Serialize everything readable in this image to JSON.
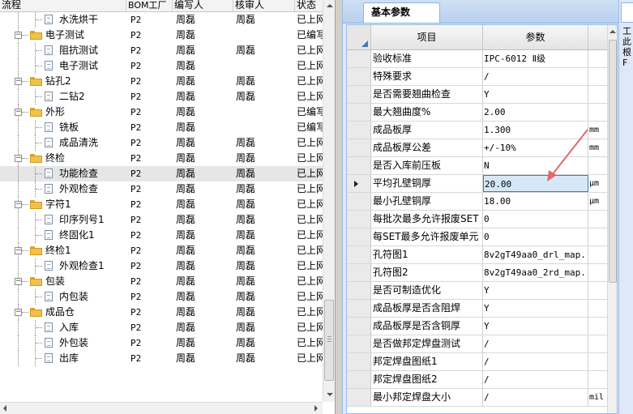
{
  "tree": {
    "columns": [
      "流程",
      "BOM工厂",
      "编写人",
      "核审人",
      "状态"
    ],
    "rows": [
      {
        "level": 2,
        "kind": "doc",
        "name": "水洗烘干",
        "bom": "P2",
        "writer": "周磊",
        "reviewer": "周磊",
        "status": "已上网"
      },
      {
        "level": 1,
        "kind": "folder",
        "name": "电子测试",
        "bom": "P2",
        "writer": "周磊",
        "reviewer": "",
        "status": "已编写"
      },
      {
        "level": 2,
        "kind": "doc",
        "name": "阻抗测试",
        "bom": "P2",
        "writer": "周磊",
        "reviewer": "周磊",
        "status": "已上网"
      },
      {
        "level": 2,
        "kind": "doc",
        "name": "电子测试",
        "bom": "P2",
        "writer": "周磊",
        "reviewer": "",
        "status": "已上网"
      },
      {
        "level": 1,
        "kind": "folder",
        "name": "钻孔2",
        "bom": "P2",
        "writer": "周磊",
        "reviewer": "周磊",
        "status": "已上网"
      },
      {
        "level": 2,
        "kind": "doc",
        "name": "二钻2",
        "bom": "P2",
        "writer": "周磊",
        "reviewer": "周磊",
        "status": "已上网"
      },
      {
        "level": 1,
        "kind": "folder",
        "name": "外形",
        "bom": "P2",
        "writer": "周磊",
        "reviewer": "",
        "status": "已编写"
      },
      {
        "level": 2,
        "kind": "doc",
        "name": "铣板",
        "bom": "P2",
        "writer": "周磊",
        "reviewer": "",
        "status": "已编写"
      },
      {
        "level": 2,
        "kind": "doc",
        "name": "成品清洗",
        "bom": "P2",
        "writer": "周磊",
        "reviewer": "周磊",
        "status": "已上网"
      },
      {
        "level": 1,
        "kind": "folder",
        "name": "终检",
        "bom": "P2",
        "writer": "周磊",
        "reviewer": "周磊",
        "status": "已上网"
      },
      {
        "level": 2,
        "kind": "doc",
        "name": "功能检查",
        "bom": "P2",
        "writer": "周磊",
        "reviewer": "周磊",
        "status": "已上网",
        "selected": true
      },
      {
        "level": 2,
        "kind": "doc",
        "name": "外观检查",
        "bom": "P2",
        "writer": "周磊",
        "reviewer": "周磊",
        "status": "已上网"
      },
      {
        "level": 1,
        "kind": "folder",
        "name": "字符1",
        "bom": "P2",
        "writer": "周磊",
        "reviewer": "周磊",
        "status": "已上网"
      },
      {
        "level": 2,
        "kind": "doc",
        "name": "印序列号1",
        "bom": "P2",
        "writer": "周磊",
        "reviewer": "周磊",
        "status": "已上网"
      },
      {
        "level": 2,
        "kind": "doc",
        "name": "终固化1",
        "bom": "P2",
        "writer": "周磊",
        "reviewer": "周磊",
        "status": "已上网"
      },
      {
        "level": 1,
        "kind": "folder",
        "name": "终检1",
        "bom": "P2",
        "writer": "周磊",
        "reviewer": "周磊",
        "status": "已上网"
      },
      {
        "level": 2,
        "kind": "doc",
        "name": "外观检查1",
        "bom": "P2",
        "writer": "周磊",
        "reviewer": "周磊",
        "status": "已上网"
      },
      {
        "level": 1,
        "kind": "folder",
        "name": "包装",
        "bom": "P2",
        "writer": "周磊",
        "reviewer": "周磊",
        "status": "已上网"
      },
      {
        "level": 2,
        "kind": "doc",
        "name": "内包装",
        "bom": "P2",
        "writer": "周磊",
        "reviewer": "周磊",
        "status": "已上网"
      },
      {
        "level": 1,
        "kind": "folder",
        "name": "成品仓",
        "bom": "P2",
        "writer": "周磊",
        "reviewer": "周磊",
        "status": "已上网"
      },
      {
        "level": 2,
        "kind": "doc",
        "name": "入库",
        "bom": "P2",
        "writer": "周磊",
        "reviewer": "周磊",
        "status": "已上网"
      },
      {
        "level": 2,
        "kind": "doc",
        "name": "外包装",
        "bom": "P2",
        "writer": "周磊",
        "reviewer": "周磊",
        "status": "已上网"
      },
      {
        "level": 2,
        "kind": "doc",
        "name": "出库",
        "bom": "P2",
        "writer": "周磊",
        "reviewer": "周磊",
        "status": "已上网"
      }
    ]
  },
  "panel": {
    "tab_label": "基本参数",
    "col_item": "项目",
    "col_param": "参数",
    "rows": [
      {
        "name": "验收标准",
        "value": "IPC-6012 Ⅱ级",
        "unit": ""
      },
      {
        "name": "特殊要求",
        "value": "/",
        "unit": ""
      },
      {
        "name": "是否需要翘曲检查",
        "value": "Y",
        "unit": ""
      },
      {
        "name": "最大翘曲度%",
        "value": "2.00",
        "unit": ""
      },
      {
        "name": "成品板厚",
        "value": "1.300",
        "unit": "mm"
      },
      {
        "name": "成品板厚公差",
        "value": "+/-10%",
        "unit": "mm"
      },
      {
        "name": "是否入库前压板",
        "value": "N",
        "unit": ""
      },
      {
        "name": "平均孔壁铜厚",
        "value": "20.00",
        "unit": "μm",
        "selected": true
      },
      {
        "name": "最小孔壁铜厚",
        "value": "18.00",
        "unit": "μm"
      },
      {
        "name": "每批次最多允许报废SET",
        "value": "0",
        "unit": ""
      },
      {
        "name": "每SET最多允许报废单元",
        "value": "0",
        "unit": ""
      },
      {
        "name": "孔符图1",
        "value": "8v2gT49aa0_drl_map...",
        "unit": ""
      },
      {
        "name": "孔符图2",
        "value": "8v2gT49aa0_2rd_map...",
        "unit": ""
      },
      {
        "name": "是否可制造优化",
        "value": "Y",
        "unit": ""
      },
      {
        "name": "成品板厚是否含阻焊",
        "value": "Y",
        "unit": ""
      },
      {
        "name": "成品板厚是否含铜厚",
        "value": "Y",
        "unit": ""
      },
      {
        "name": "是否做邦定焊盘测试",
        "value": "/",
        "unit": ""
      },
      {
        "name": "邦定焊盘图纸1",
        "value": "/",
        "unit": ""
      },
      {
        "name": "邦定焊盘图纸2",
        "value": "/",
        "unit": ""
      },
      {
        "name": "最小邦定焊盘大小",
        "value": "/",
        "unit": "mil"
      }
    ]
  },
  "farright": {
    "text": "工 此 根 F"
  },
  "colors": {
    "accent": "#4a76b8",
    "annotation": "#e06a6a",
    "folder": "#f2c14a"
  }
}
